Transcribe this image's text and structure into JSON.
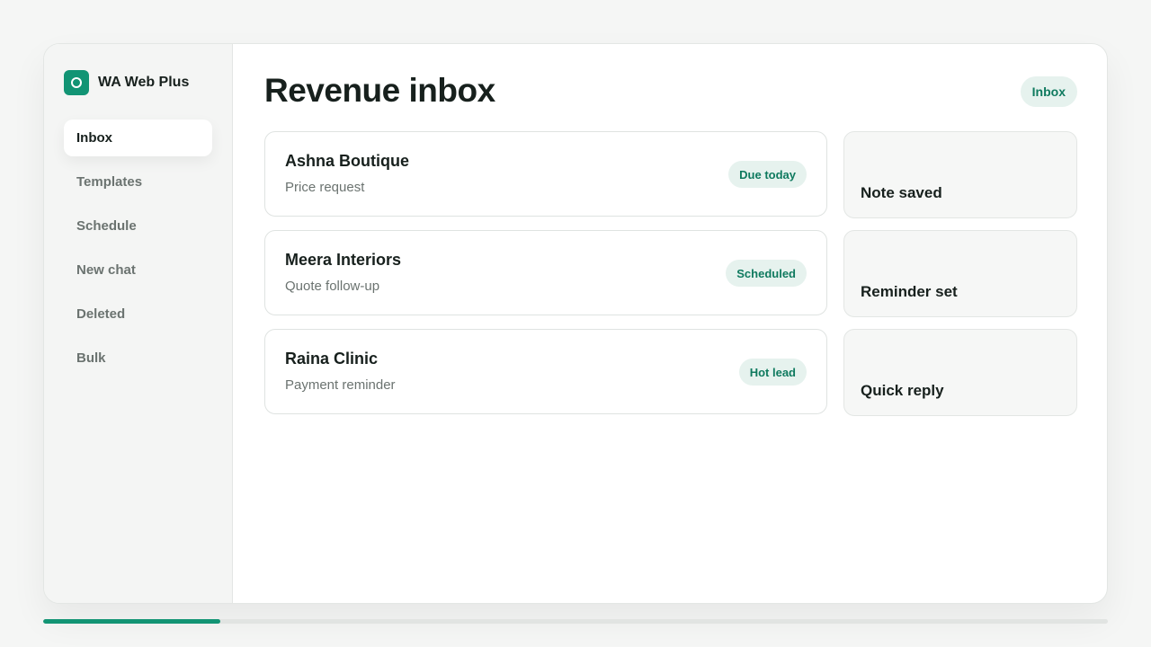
{
  "app": {
    "name": "WA Web Plus",
    "accent_color": "#129474"
  },
  "sidebar": {
    "items": [
      {
        "label": "Inbox",
        "active": true
      },
      {
        "label": "Templates",
        "active": false
      },
      {
        "label": "Schedule",
        "active": false
      },
      {
        "label": "New chat",
        "active": false
      },
      {
        "label": "Deleted",
        "active": false
      },
      {
        "label": "Bulk",
        "active": false
      }
    ]
  },
  "main": {
    "title": "Revenue inbox",
    "badge": "Inbox",
    "conversations": [
      {
        "name": "Ashna Boutique",
        "subtitle": "Price request",
        "status": "Due today"
      },
      {
        "name": "Meera Interiors",
        "subtitle": "Quote follow-up",
        "status": "Scheduled"
      },
      {
        "name": "Raina Clinic",
        "subtitle": "Payment reminder",
        "status": "Hot lead"
      }
    ],
    "actions": [
      {
        "label": "Note saved"
      },
      {
        "label": "Reminder set"
      },
      {
        "label": "Quick reply"
      }
    ]
  },
  "progress": {
    "fraction": 0.166
  }
}
